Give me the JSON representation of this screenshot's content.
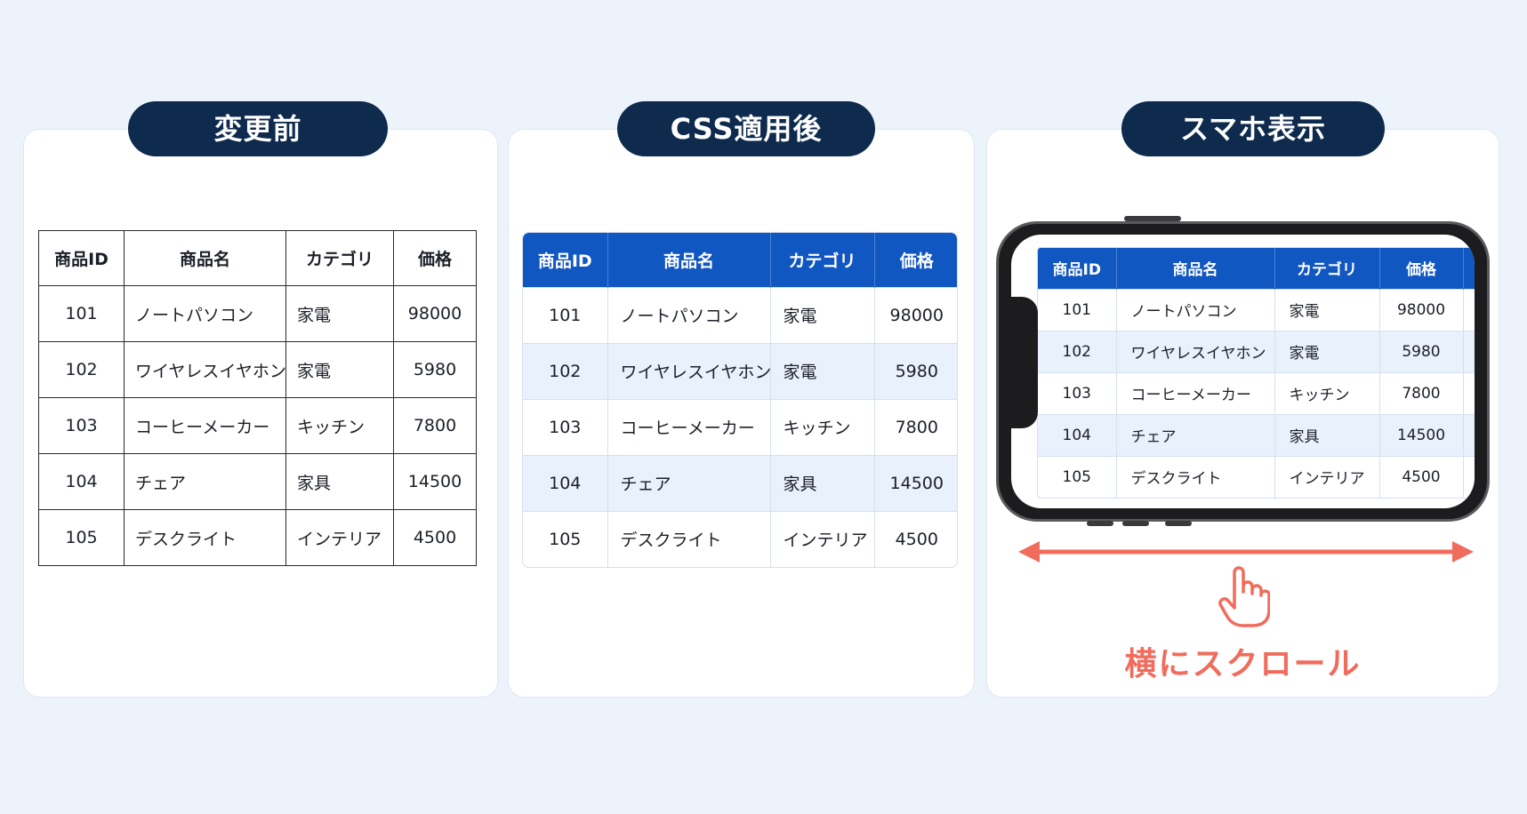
{
  "panels": {
    "before": {
      "title": "変更前"
    },
    "after": {
      "title": "CSS適用後"
    },
    "mobile": {
      "title": "スマホ表示",
      "scroll_label": "横にスクロール"
    }
  },
  "table": {
    "headers": [
      "商品ID",
      "商品名",
      "カテゴリ",
      "価格"
    ],
    "rows": [
      [
        "101",
        "ノートパソコン",
        "家電",
        "98000"
      ],
      [
        "102",
        "ワイヤレスイヤホン",
        "家電",
        "5980"
      ],
      [
        "103",
        "コーヒーメーカー",
        "キッチン",
        "7800"
      ],
      [
        "104",
        "チェア",
        "家具",
        "14500"
      ],
      [
        "105",
        "デスクライト",
        "インテリア",
        "4500"
      ]
    ]
  },
  "colors": {
    "header_bg": "#1157c2",
    "pill_bg": "#0e2a4d",
    "accent": "#f06c5c",
    "stripe": "#e9f1fc"
  },
  "icons": {
    "arrow": "double-arrow-horizontal-icon",
    "hand": "pointing-hand-icon"
  }
}
